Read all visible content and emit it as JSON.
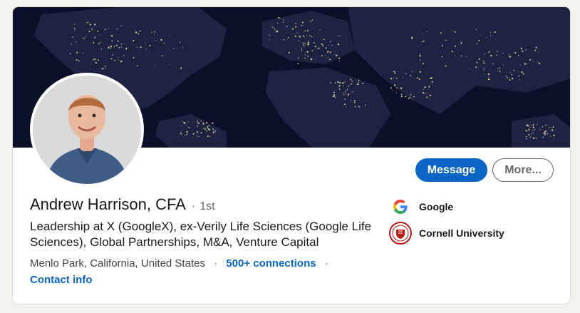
{
  "profile": {
    "name": "Andrew Harrison, CFA",
    "separator": "·",
    "degree": "1st",
    "headline": "Leadership at X (GoogleX), ex-Verily Life Sciences (Google Life Sciences), Global Partnerships, M&A, Venture Capital",
    "location": "Menlo Park, California, United States",
    "dot": "·",
    "connections": "500+ connections",
    "contact_info": "Contact info"
  },
  "actions": {
    "message_label": "Message",
    "more_label": "More..."
  },
  "organizations": [
    {
      "name": "Google",
      "logo": "google-logo"
    },
    {
      "name": "Cornell University",
      "logo": "cornell-seal"
    }
  ],
  "colors": {
    "accent": "#0a66c2",
    "banner": "#0b1028",
    "page_bg": "#f3f2ef"
  }
}
